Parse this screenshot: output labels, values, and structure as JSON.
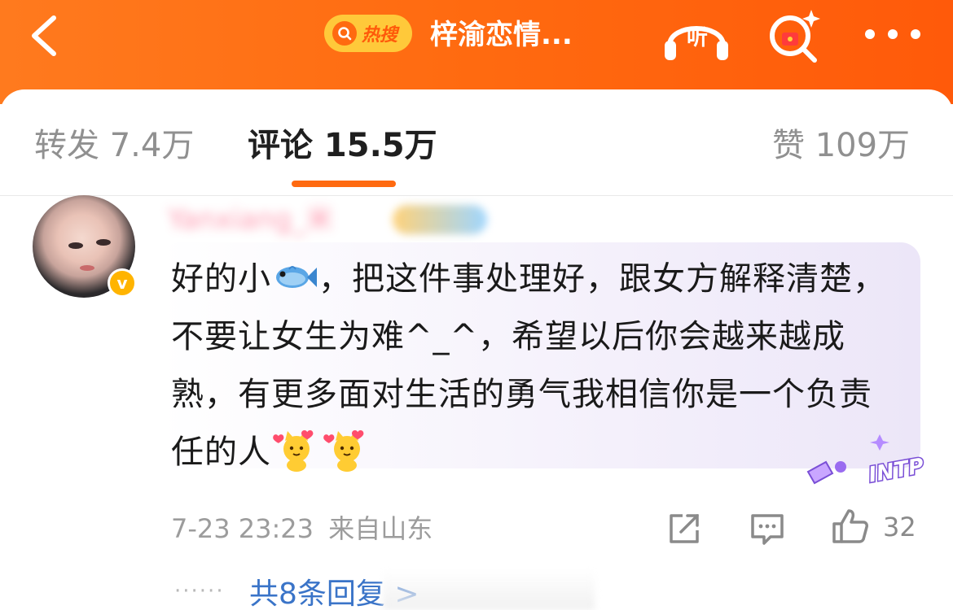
{
  "header": {
    "back_icon": "chevron-left-icon",
    "hot_label": "热搜",
    "topic_title": "梓渝恋情...",
    "listen_label": "听",
    "search_icon": "search-sparkle-icon",
    "more_icon": "more-dots-icon",
    "bg_color": "#ff6a10",
    "badge_color": "#ffc93a"
  },
  "tabs": {
    "repost": "转发 7.4万",
    "comments": "评论 15.5万",
    "likes": "赞 109万",
    "active": "comments",
    "accent_color": "#ff6a10"
  },
  "comment": {
    "username": "Yanxiang_米",
    "verified_mark": "v",
    "lines": [
      "好的小",
      "，把这件事处理好，跟女方解释清楚，不要让女生为难^_^，希望以后你会越来越成熟，有更多面对生活的勇气我相信你是一个负责任的人"
    ],
    "emoji_inline": "fish-emoji",
    "emoji_end": [
      "cat-heart-emoji",
      "cat-heart-emoji"
    ],
    "sticker_label": "INTP",
    "timestamp": "7-23 23:23",
    "location": "来自山东",
    "like_count": "32",
    "replies_link": "共8条回复 >"
  }
}
